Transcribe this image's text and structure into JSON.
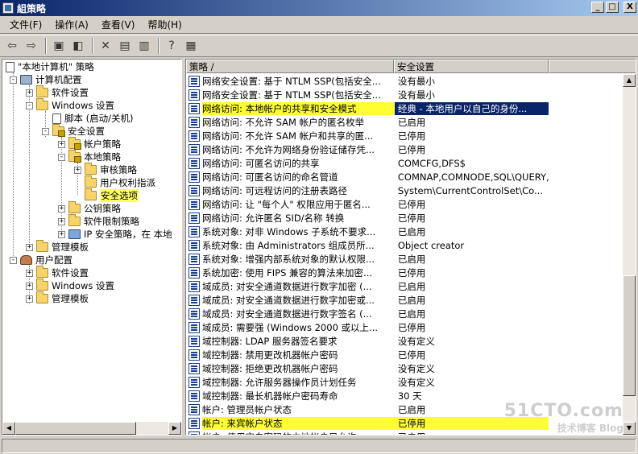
{
  "window": {
    "title": "組策略",
    "min_label": "_",
    "max_label": "□",
    "close_label": "X"
  },
  "menu": [
    {
      "label": "文件(F)"
    },
    {
      "label": "操作(A)"
    },
    {
      "label": "查看(V)"
    },
    {
      "label": "帮助(H)"
    }
  ],
  "toolbar": {
    "icons": [
      "back-icon",
      "forward-icon",
      "up-folder-icon",
      "show-hide-tree-icon",
      "delete-icon",
      "properties-icon",
      "refresh-icon",
      "export-list-icon",
      "help-icon",
      "console-icon"
    ]
  },
  "tree": [
    {
      "label": "\"本地计算机\" 策略",
      "level": 0,
      "expander": "",
      "icon": "doc"
    },
    {
      "label": "计算机配置",
      "level": 1,
      "expander": "-",
      "icon": "computer"
    },
    {
      "label": "软件设置",
      "level": 2,
      "expander": "+",
      "icon": "folder"
    },
    {
      "label": "Windows 设置",
      "level": 2,
      "expander": "-",
      "icon": "folder"
    },
    {
      "label": "脚本 (启动/关机)",
      "level": 3,
      "expander": "",
      "icon": "doc"
    },
    {
      "label": "安全设置",
      "level": 3,
      "expander": "-",
      "icon": "lock"
    },
    {
      "label": "帐户策略",
      "level": 4,
      "expander": "+",
      "icon": "lock"
    },
    {
      "label": "本地策略",
      "level": 4,
      "expander": "-",
      "icon": "lock"
    },
    {
      "label": "审核策略",
      "level": 5,
      "expander": "+",
      "icon": "folder"
    },
    {
      "label": "用户权利指派",
      "level": 5,
      "expander": "",
      "icon": "folder"
    },
    {
      "label": "安全选项",
      "level": 5,
      "expander": "",
      "icon": "folder",
      "highlight": true
    },
    {
      "label": "公钥策略",
      "level": 4,
      "expander": "+",
      "icon": "folder"
    },
    {
      "label": "软件限制策略",
      "level": 4,
      "expander": "+",
      "icon": "folder"
    },
    {
      "label": "IP 安全策略，在 本地",
      "level": 4,
      "expander": "+",
      "icon": "net"
    },
    {
      "label": "管理模板",
      "level": 2,
      "expander": "+",
      "icon": "folder"
    },
    {
      "label": "用户配置",
      "level": 1,
      "expander": "-",
      "icon": "user"
    },
    {
      "label": "软件设置",
      "level": 2,
      "expander": "+",
      "icon": "folder"
    },
    {
      "label": "Windows 设置",
      "level": 2,
      "expander": "+",
      "icon": "folder"
    },
    {
      "label": "管理模板",
      "level": 2,
      "expander": "+",
      "icon": "folder"
    }
  ],
  "list": {
    "columns": {
      "policy": "策略 /",
      "setting": "安全设置"
    },
    "rows": [
      {
        "policy": "网络安全设置: 基于 NTLM SSP(包括安全...",
        "setting": "没有最小"
      },
      {
        "policy": "网络安全设置: 基于 NTLM SSP(包括安全...",
        "setting": "没有最小"
      },
      {
        "policy": "网络访问: 本地帐户的共享和安全模式",
        "setting": "经典 - 本地用户以自己的身份...",
        "selected": true
      },
      {
        "policy": "网络访问: 不允许 SAM 帐户的匿名枚举",
        "setting": "已启用"
      },
      {
        "policy": "网络访问: 不允许 SAM 帐户和共享的匿...",
        "setting": "已停用"
      },
      {
        "policy": "网络访问: 不允许为网络身份验证储存凭...",
        "setting": "已停用"
      },
      {
        "policy": "网络访问: 可匿名访问的共享",
        "setting": "COMCFG,DFS$"
      },
      {
        "policy": "网络访问: 可匿名访问的命名管道",
        "setting": "COMNAP,COMNODE,SQL\\QUERY,SP..."
      },
      {
        "policy": "网络访问: 可远程访问的注册表路径",
        "setting": "System\\CurrentControlSet\\Co..."
      },
      {
        "policy": "网络访问: 让 \"每个人\" 权限应用于匿名...",
        "setting": "已停用"
      },
      {
        "policy": "网络访问: 允许匿名 SID/名称 转换",
        "setting": "已停用"
      },
      {
        "policy": "系统对象: 对非 Windows 子系统不要求...",
        "setting": "已启用"
      },
      {
        "policy": "系统对象: 由 Administrators 组成员所...",
        "setting": "Object creator"
      },
      {
        "policy": "系统对象: 增强内部系统对象的默认权限...",
        "setting": "已启用"
      },
      {
        "policy": "系统加密: 使用 FIPS 兼容的算法来加密...",
        "setting": "已停用"
      },
      {
        "policy": "域成员: 对安全通道数据进行数字加密 (...",
        "setting": "已启用"
      },
      {
        "policy": "域成员: 对安全通道数据进行数字加密或...",
        "setting": "已启用"
      },
      {
        "policy": "域成员: 对安全通道数据进行数字签名 (...",
        "setting": "已启用"
      },
      {
        "policy": "域成员: 需要强 (Windows 2000 或以上...",
        "setting": "已停用"
      },
      {
        "policy": "域控制器: LDAP 服务器签名要求",
        "setting": "没有定义"
      },
      {
        "policy": "域控制器: 禁用更改机器帐户密码",
        "setting": "已停用"
      },
      {
        "policy": "域控制器: 拒绝更改机器帐户密码",
        "setting": "没有定义"
      },
      {
        "policy": "域控制器: 允许服务器操作员计划任务",
        "setting": "没有定义"
      },
      {
        "policy": "域控制器: 最长机器帐户密码寿命",
        "setting": "30 天"
      },
      {
        "policy": "帐户: 管理员帐户状态",
        "setting": "已启用"
      },
      {
        "policy": "帐户: 来宾帐户状态",
        "setting": "已停用",
        "highlight": true
      },
      {
        "policy": "帐户: 使用空白密码的本地帐户只允许...",
        "setting": "已启用"
      }
    ]
  },
  "watermark": {
    "main": "51CTO.com",
    "sub": "技术博客   Blog"
  },
  "colors": {
    "title_bar": "#0a246a",
    "selection": "#0a246a",
    "highlight": "#ffff33"
  }
}
